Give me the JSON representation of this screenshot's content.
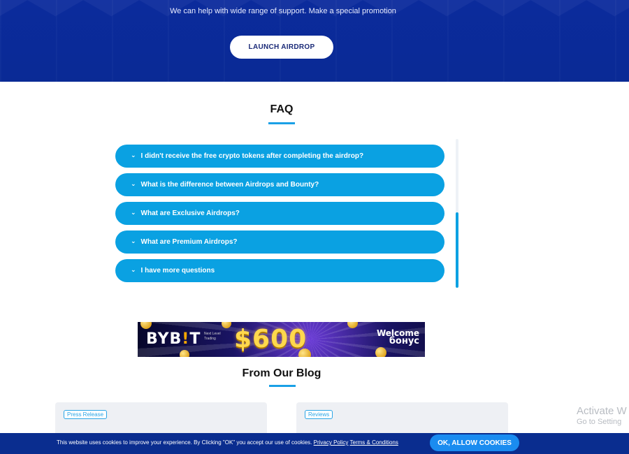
{
  "hero": {
    "text": "We can help with wide range of support. Make a special promotion",
    "button_label": "LAUNCH AIRDROP"
  },
  "faq": {
    "title": "FAQ",
    "chevron_icon": "chevron-down-icon",
    "items": [
      {
        "label": "I didn't receive the free crypto tokens after completing the airdrop?"
      },
      {
        "label": "What is the difference between Airdrops and Bounty?"
      },
      {
        "label": "What are Exclusive Airdrops?"
      },
      {
        "label": "What are Premium Airdrops?"
      },
      {
        "label": "I have more questions"
      }
    ],
    "accent_color": "#0aa1e2"
  },
  "ad": {
    "brand_left": "BYB",
    "brand_bang": "!",
    "brand_right": "T",
    "tagline": "Next Level Trading",
    "amount": "$600",
    "welcome_line1": "Welcome",
    "welcome_line2": "бонус"
  },
  "blog": {
    "title": "From Our Blog",
    "cards": [
      {
        "tag": "Press Release"
      },
      {
        "tag": "Reviews"
      }
    ]
  },
  "watermark": {
    "line1": "Activate W",
    "line2": "Go to Setting"
  },
  "cookie": {
    "text": "This website uses cookies to improve your experience. By Clicking \"OK\" you accept our use of cookies.",
    "privacy_link": "Privacy Policy",
    "terms_link": "Terms & Conditions",
    "button_label": "OK, ALLOW COOKIES"
  },
  "colors": {
    "hero_bg": "#0a2a95",
    "accent": "#0aa1e2",
    "cookie_bg": "#0a2d8f",
    "cookie_button": "#1a8cf0"
  }
}
